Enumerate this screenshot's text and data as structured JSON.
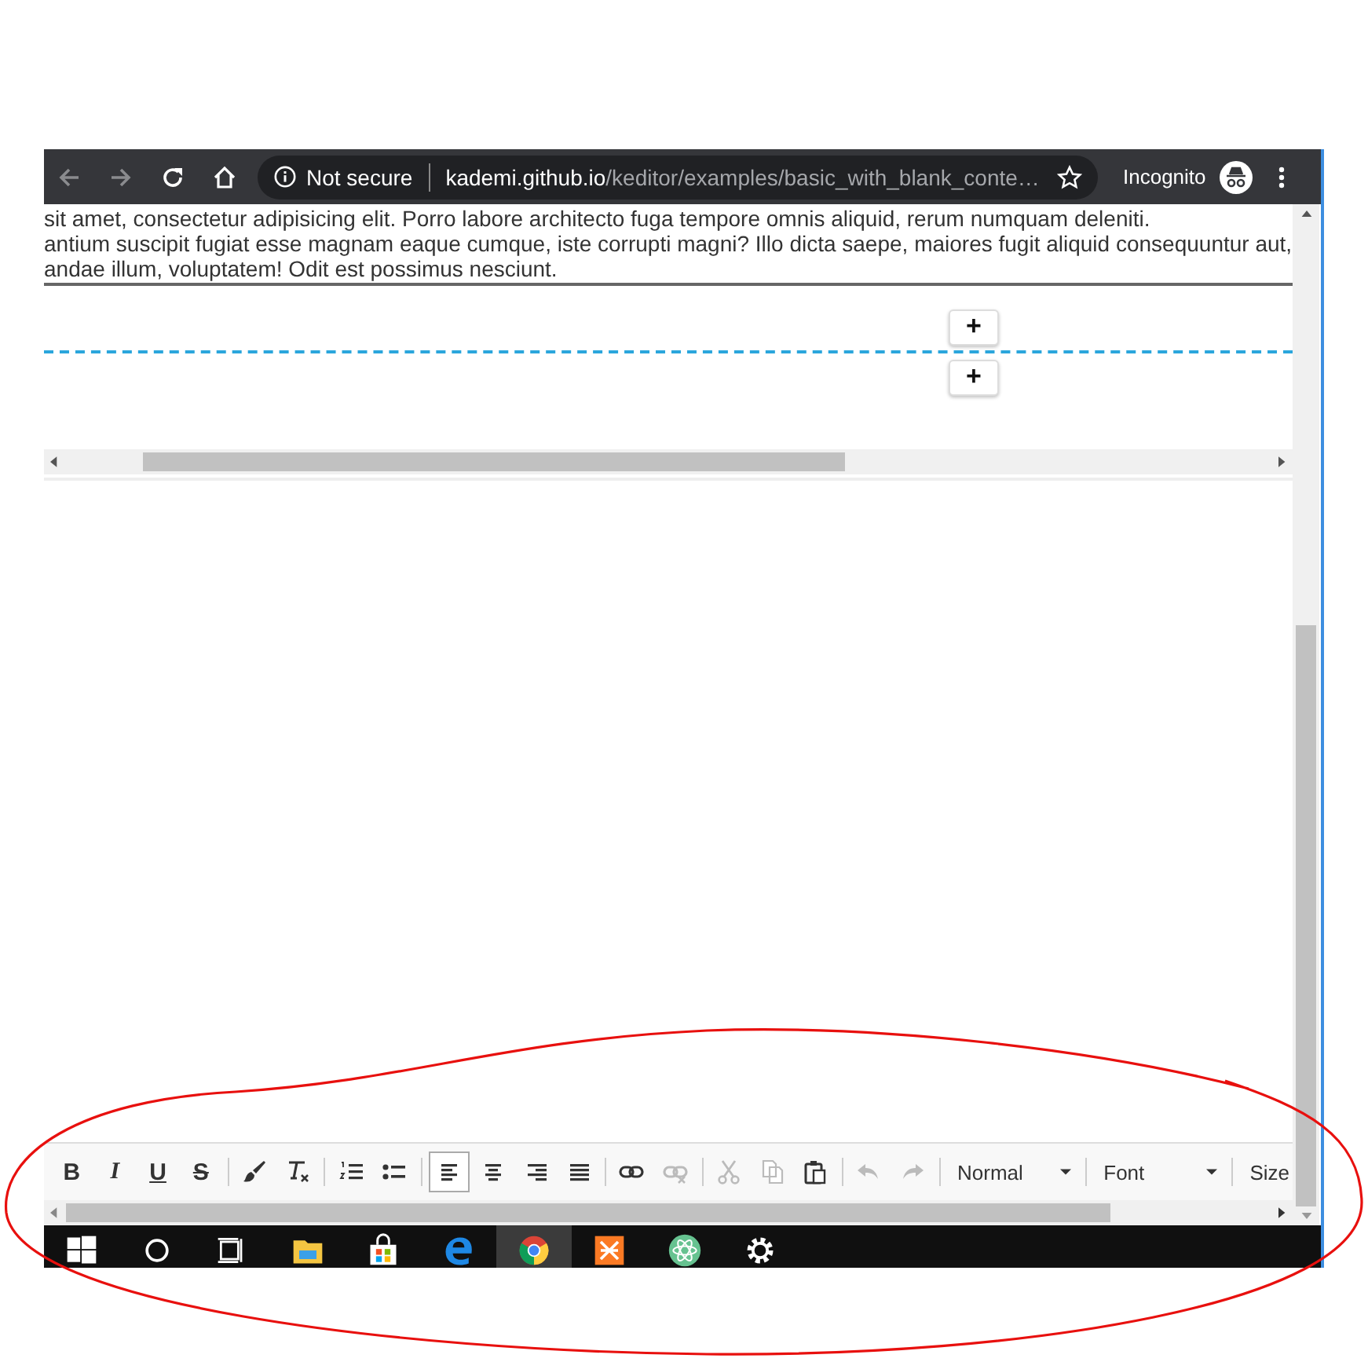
{
  "browser": {
    "back_disabled": true,
    "forward_disabled": true,
    "security": "Not secure",
    "url_host": "kademi.github.io",
    "url_path": "/keditor/examples/basic_with_blank_conte…",
    "mode": "Incognito"
  },
  "content": {
    "lines": [
      "sit amet, consectetur adipisicing elit. Porro labore architecto fuga tempore omnis aliquid, rerum numquam deleniti.",
      "antium suscipit fugiat esse magnam eaque cumque, iste corrupti magni? Illo dicta saepe, maiores fugit aliquid consequuntur aut,",
      "andae illum, voluptatem! Odit est possimus nesciunt."
    ],
    "add_buttons": [
      "+",
      "+"
    ]
  },
  "toolbar": {
    "groups": [
      [
        {
          "kind": "bold",
          "label": "B",
          "selected": false,
          "disabled": false
        },
        {
          "kind": "italic",
          "label": "I",
          "selected": false,
          "disabled": false
        },
        {
          "kind": "underline",
          "label": "U",
          "selected": false,
          "disabled": false
        },
        {
          "kind": "strike",
          "label": "S",
          "selected": false,
          "disabled": false
        }
      ],
      [
        {
          "kind": "brush",
          "selected": false,
          "disabled": false
        },
        {
          "kind": "clear",
          "selected": false,
          "disabled": false
        }
      ],
      [
        {
          "kind": "numbered",
          "selected": false,
          "disabled": false
        },
        {
          "kind": "bulleted",
          "selected": false,
          "disabled": false
        }
      ],
      [
        {
          "kind": "alignleft",
          "selected": true,
          "disabled": false
        },
        {
          "kind": "aligncenter",
          "selected": false,
          "disabled": false
        },
        {
          "kind": "alignright",
          "selected": false,
          "disabled": false
        },
        {
          "kind": "justify",
          "selected": false,
          "disabled": false
        }
      ],
      [
        {
          "kind": "link",
          "selected": false,
          "disabled": false
        },
        {
          "kind": "unlink",
          "selected": false,
          "disabled": true
        }
      ],
      [
        {
          "kind": "cut",
          "selected": false,
          "disabled": true
        },
        {
          "kind": "copy",
          "selected": false,
          "disabled": true
        },
        {
          "kind": "paste",
          "selected": false,
          "disabled": false
        }
      ],
      [
        {
          "kind": "undo",
          "selected": false,
          "disabled": true
        },
        {
          "kind": "redo",
          "selected": false,
          "disabled": true
        }
      ]
    ],
    "dropdowns": [
      "Normal",
      "Font",
      "Size"
    ]
  },
  "taskbar": [
    {
      "kind": "start",
      "active": false
    },
    {
      "kind": "search",
      "active": false
    },
    {
      "kind": "taskview",
      "active": false
    },
    {
      "kind": "folder",
      "active": false
    },
    {
      "kind": "store",
      "active": false
    },
    {
      "kind": "edge",
      "active": false
    },
    {
      "kind": "chrome",
      "active": true
    },
    {
      "kind": "xampp",
      "active": false
    },
    {
      "kind": "atom",
      "active": false
    },
    {
      "kind": "gear",
      "active": false
    }
  ]
}
